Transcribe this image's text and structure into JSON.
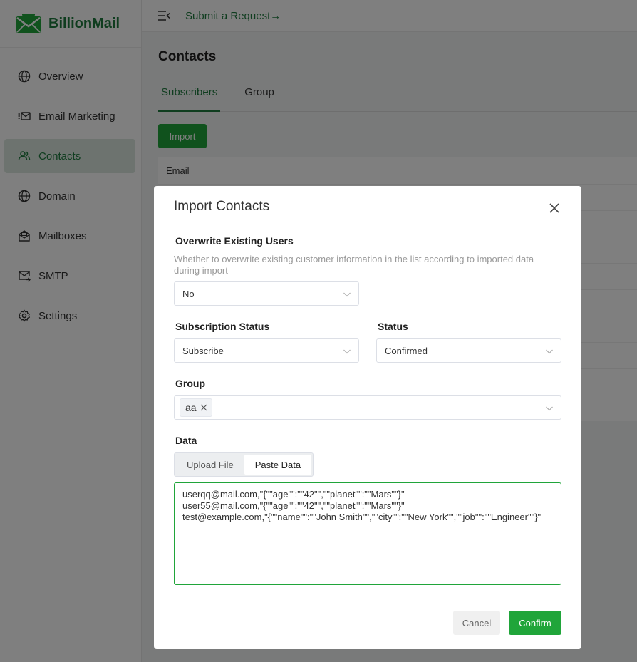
{
  "app": {
    "name": "BillionMail"
  },
  "sidebar": {
    "items": [
      {
        "label": "Overview",
        "icon": "globe-icon"
      },
      {
        "label": "Email Marketing",
        "icon": "email-marketing-icon"
      },
      {
        "label": "Contacts",
        "icon": "contacts-icon",
        "active": true
      },
      {
        "label": "Domain",
        "icon": "globe-icon"
      },
      {
        "label": "Mailboxes",
        "icon": "mailbox-icon"
      },
      {
        "label": "SMTP",
        "icon": "smtp-icon"
      },
      {
        "label": "Settings",
        "icon": "gear-icon"
      }
    ]
  },
  "topbar": {
    "submit_label": "Submit a Request",
    "submit_arrow": "→"
  },
  "page": {
    "title": "Contacts",
    "tabs": [
      {
        "label": "Subscribers",
        "active": true
      },
      {
        "label": "Group"
      }
    ],
    "import_label": "Import",
    "table_header_email": "Email"
  },
  "dialog": {
    "title": "Import Contacts",
    "overwrite": {
      "label": "Overwrite Existing Users",
      "description": "Whether to overwrite existing customer information in the list according to imported data during import",
      "value": "No"
    },
    "subscription_status": {
      "label": "Subscription Status",
      "value": "Subscribe"
    },
    "status": {
      "label": "Status",
      "value": "Confirmed"
    },
    "group": {
      "label": "Group",
      "tag": "aa"
    },
    "data": {
      "label": "Data",
      "upload_file_label": "Upload File",
      "paste_data_label": "Paste Data",
      "content": "userqq@mail.com,\"{\"\"age\"\":\"\"42\"\",\"\"planet\"\":\"\"Mars\"\"}\"\nuser55@mail.com,\"{\"\"age\"\":\"\"42\"\",\"\"planet\"\":\"\"Mars\"\"}\"\ntest@example.com,\"{\"\"name\"\":\"\"John Smith\"\",\"\"city\"\":\"\"New York\"\",\"\"job\"\":\"\"Engineer\"\"}\""
    },
    "cancel_label": "Cancel",
    "confirm_label": "Confirm"
  },
  "colors": {
    "accent": "#20a53a",
    "accent_dark": "#1f7a3e"
  }
}
